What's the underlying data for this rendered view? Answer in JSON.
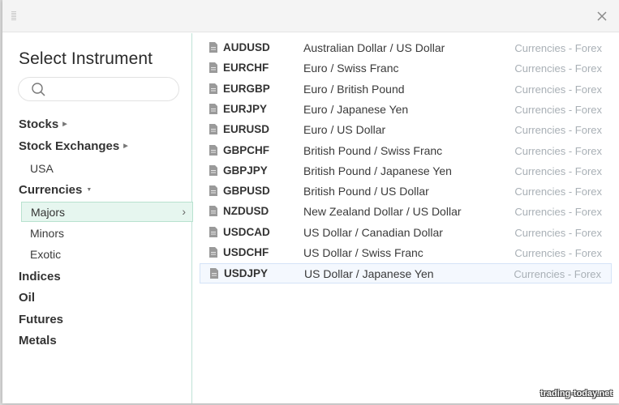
{
  "dialog": {
    "title": "Select Instrument",
    "close_icon": "close-icon",
    "drag_icon": "drag-handle-icon"
  },
  "search": {
    "value": "",
    "placeholder": "",
    "icon": "search-icon"
  },
  "sidebar": {
    "categories": [
      {
        "label": "Stocks",
        "indicator": "▶"
      },
      {
        "label": "Stock Exchanges",
        "indicator": "▶"
      },
      {
        "label": "USA",
        "level": "sub"
      },
      {
        "label": "Currencies",
        "indicator": "▼"
      },
      {
        "label": "Majors",
        "level": "sub",
        "selected": true,
        "chevron": "›"
      },
      {
        "label": "Minors",
        "level": "sub"
      },
      {
        "label": "Exotic",
        "level": "sub"
      },
      {
        "label": "Indices"
      },
      {
        "label": "Oil"
      },
      {
        "label": "Futures"
      },
      {
        "label": "Metals"
      }
    ]
  },
  "instruments": [
    {
      "symbol": "AUDUSD",
      "description": "Australian Dollar / US Dollar",
      "type": "Currencies - Forex"
    },
    {
      "symbol": "EURCHF",
      "description": "Euro / Swiss Franc",
      "type": "Currencies - Forex"
    },
    {
      "symbol": "EURGBP",
      "description": "Euro / British Pound",
      "type": "Currencies - Forex"
    },
    {
      "symbol": "EURJPY",
      "description": "Euro / Japanese Yen",
      "type": "Currencies - Forex"
    },
    {
      "symbol": "EURUSD",
      "description": "Euro / US Dollar",
      "type": "Currencies - Forex"
    },
    {
      "symbol": "GBPCHF",
      "description": "British Pound / Swiss Franc",
      "type": "Currencies - Forex"
    },
    {
      "symbol": "GBPJPY",
      "description": "British Pound / Japanese Yen",
      "type": "Currencies - Forex"
    },
    {
      "symbol": "GBPUSD",
      "description": "British Pound / US Dollar",
      "type": "Currencies - Forex"
    },
    {
      "symbol": "NZDUSD",
      "description": "New Zealand Dollar / US Dollar",
      "type": "Currencies - Forex"
    },
    {
      "symbol": "USDCAD",
      "description": "US Dollar / Canadian Dollar",
      "type": "Currencies - Forex"
    },
    {
      "symbol": "USDCHF",
      "description": "US Dollar / Swiss Franc",
      "type": "Currencies - Forex"
    },
    {
      "symbol": "USDJPY",
      "description": "US Dollar / Japanese Yen",
      "type": "Currencies - Forex",
      "selected": true
    }
  ],
  "watermark": "trading-today.net",
  "colors": {
    "accent_border": "#b8e2cf",
    "accent_bg": "#e6f6ef",
    "selected_row_bg": "#f4f8fe",
    "selected_row_border": "#d4e3f7",
    "muted_text": "#a9b0b6"
  }
}
